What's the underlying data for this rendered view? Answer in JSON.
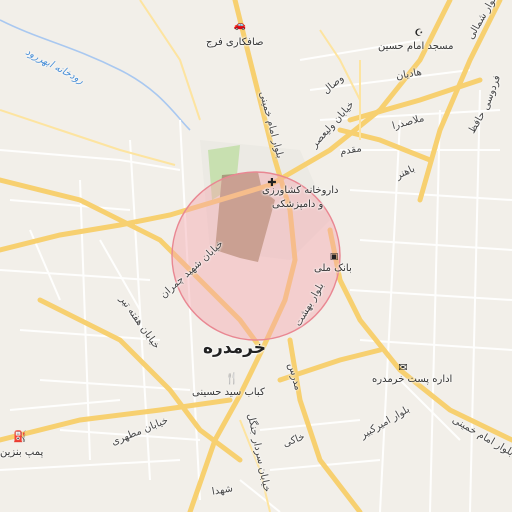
{
  "map": {
    "city_label": "خرمدره",
    "water_label": "رودخانه ابهررود",
    "highlight_color": "#ee8f98",
    "road_labels": {
      "imam_khomeini_north": "بلوار امام خمینی",
      "imam_khomeini_south": "بلوار امام خمینی",
      "valiasr": "خیابان ولیعصر",
      "vesal": "وصال",
      "shahid_chamran": "خیابان شهید چمران",
      "hafte_tir": "خیابان هفته تیر",
      "motahari": "خیابان مطهری",
      "sardar_jangal": "خیابان سردار جنگل",
      "amir_kabir": "بلوار امیرکبیر",
      "behesht": "بلوار بهشت",
      "modarres": "مدرس",
      "khaki": "خاکی",
      "shohada": "شهدا",
      "hafez": "حافظ",
      "hadi": "هادیان",
      "mollasadra": "ملاصدرا",
      "moghadam": "مقدم",
      "bahonar": "باهنر",
      "ferdowsi": "فردوسی",
      "shomali": "بلوار شمالی"
    },
    "pois": {
      "car_repair": "صافکاری فرج",
      "mosque": "مسجد امام حسین",
      "pharmacy_line1": "داروخانه کشاورزی",
      "pharmacy_line2": "و دامپزشکی",
      "bank": "بانک ملی",
      "post_office": "اداره پست خرمدره",
      "kebab": "کباب سید حسینی",
      "gas_station": "پمپ بنزین"
    }
  }
}
